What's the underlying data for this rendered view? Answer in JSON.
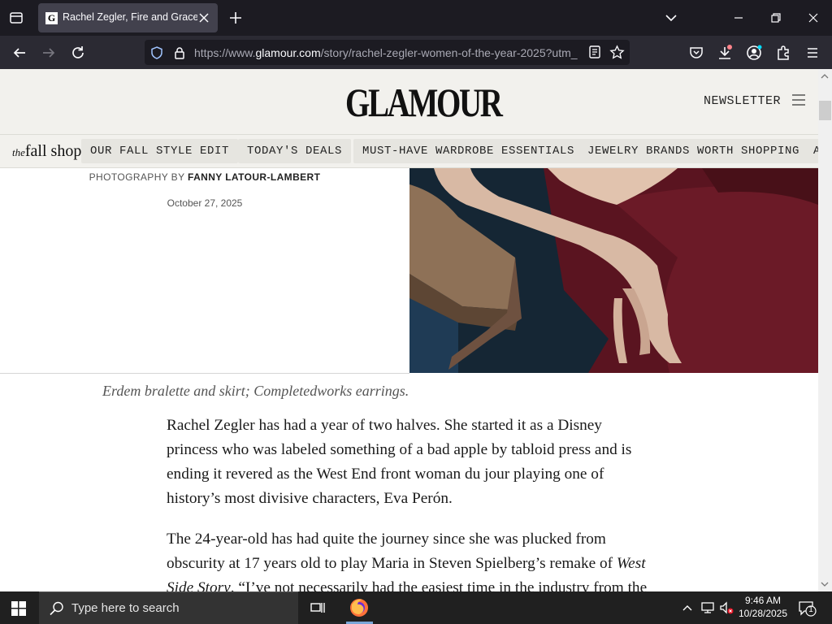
{
  "browser": {
    "tab_title": "Rachel Zegler, Fire and Grace | Glamour",
    "tab_favicon": "G",
    "url_prefix": "https://www.",
    "url_domain": "glamour.com",
    "url_path": "/story/rachel-zegler-women-of-the-year-2025?utm_"
  },
  "site": {
    "logo": "GLAMOUR",
    "newsletter_label": "NEWSLETTER",
    "fallshop_the": "the",
    "fallshop_label": "fall shop",
    "categories": [
      "OUR FALL STYLE EDIT",
      "TODAY'S DEALS",
      "MUST-HAVE WARDROBE ESSENTIALS",
      "JEWELRY BRANDS WORTH SHOPPING",
      "A"
    ]
  },
  "article": {
    "byline_prefix": "PHOTOGRAPHY BY",
    "photographer": "FANNY LATOUR-LAMBERT",
    "date": "October 27, 2025",
    "caption": "Erdem bralette and skirt; Completedworks earrings.",
    "para1": "Rachel Zegler has had a year of two halves. She started it as a Disney princess who was labeled something of a bad apple by tabloid press and is ending it revered as the West End front woman du jour playing one of history’s most divisive characters, Eva Perón.",
    "para2_start": "The 24-year-old has had quite the journey since she was plucked from obscurity at 17 years old to play Maria in Steven Spielberg’s remake of ",
    "para2_italic": "West Side Story",
    "para2_end": ". “I’ve not necessarily had the easiest time in the industry from the"
  },
  "taskbar": {
    "search_placeholder": "Type here to search",
    "time": "9:46 AM",
    "date": "10/28/2025",
    "notification_count": "1"
  },
  "colors": {
    "chrome_dark": "#1c1b22",
    "navbar": "#2b2a33",
    "site_header_bg": "#f2f1ed",
    "skirt": "#5a1420",
    "firefox_accent": "#ff7139"
  }
}
